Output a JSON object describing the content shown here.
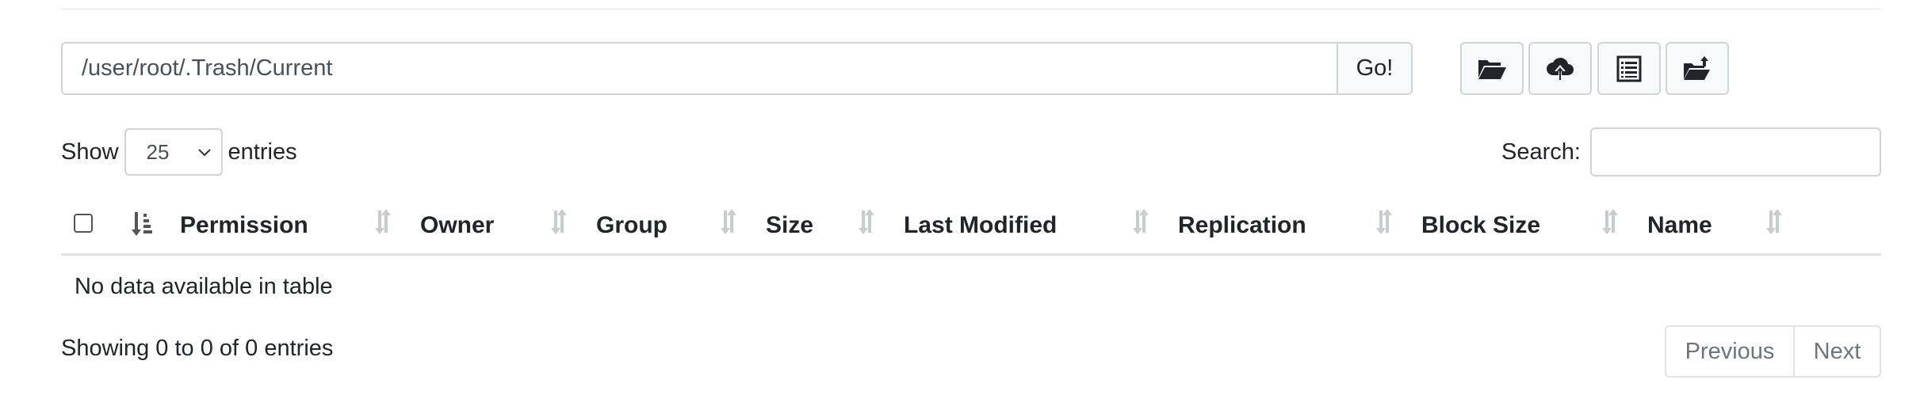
{
  "path_bar": {
    "value": "/user/root/.Trash/Current",
    "go_label": "Go!"
  },
  "toolbar": {
    "icons": [
      "folder-open-icon",
      "cloud-upload-icon",
      "list-view-icon",
      "folder-move-icon"
    ]
  },
  "length": {
    "show_label": "Show",
    "selected": "25",
    "entries_label": "entries"
  },
  "search": {
    "label": "Search:",
    "value": ""
  },
  "table": {
    "columns": [
      "Permission",
      "Owner",
      "Group",
      "Size",
      "Last Modified",
      "Replication",
      "Block Size",
      "Name"
    ],
    "empty_message": "No data available in table"
  },
  "footer": {
    "info": "Showing 0 to 0 of 0 entries",
    "previous_label": "Previous",
    "next_label": "Next"
  },
  "colors": {
    "border": "#ced4da",
    "button_bg": "#f8f9fa",
    "muted": "#6c757d",
    "sort_icon": "#c8cbcf"
  }
}
